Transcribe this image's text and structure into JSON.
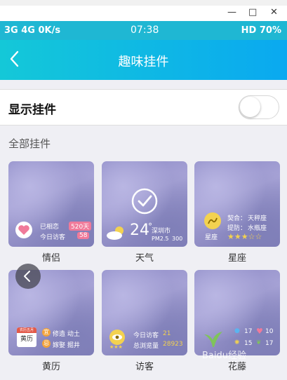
{
  "window_controls": {
    "minimize": "—",
    "maximize": "□",
    "close": "✕"
  },
  "status_bar": {
    "left": "3G 4G 0K/s",
    "time": "07:38",
    "right": "HD 70%"
  },
  "header": {
    "title": "趣味挂件",
    "back_icon": "chevron-left-icon"
  },
  "show_widgets": {
    "label": "显示挂件",
    "enabled": false
  },
  "section": {
    "label": "全部挂件"
  },
  "widgets": [
    {
      "name": "情侣",
      "line1": "已相恋",
      "badge1": "520天",
      "line2": "今日访客",
      "badge2": "58",
      "icon": "heart-icon"
    },
    {
      "name": "天气",
      "temp": "24",
      "deg": "°",
      "city": "深圳市",
      "aq_label": "PM2.5",
      "aq_value": "300",
      "selected": true,
      "icon": "check-circle-icon"
    },
    {
      "name": "星座",
      "match_label": "契合：",
      "match_value": "天秤座",
      "luck_label": "提防：",
      "luck_value": "水瓶座",
      "sign_label": "星座",
      "stars": "★★★☆☆"
    },
    {
      "name": "黄历",
      "cal_top": "农历五月",
      "cal_main": "黄历",
      "good_mark": "宜",
      "good_text": "修造 动土",
      "bad_mark": "忌",
      "bad_text": "嫁娶 掘井"
    },
    {
      "name": "访客",
      "today_label": "今日访客",
      "today_value": "21",
      "total_label": "总浏览量",
      "total_value": "28923",
      "stars": "★★★"
    },
    {
      "name": "花藤",
      "v1": "17",
      "v2": "10",
      "v3": "15",
      "v4": "17"
    }
  ],
  "watermark": "Baidu经验"
}
